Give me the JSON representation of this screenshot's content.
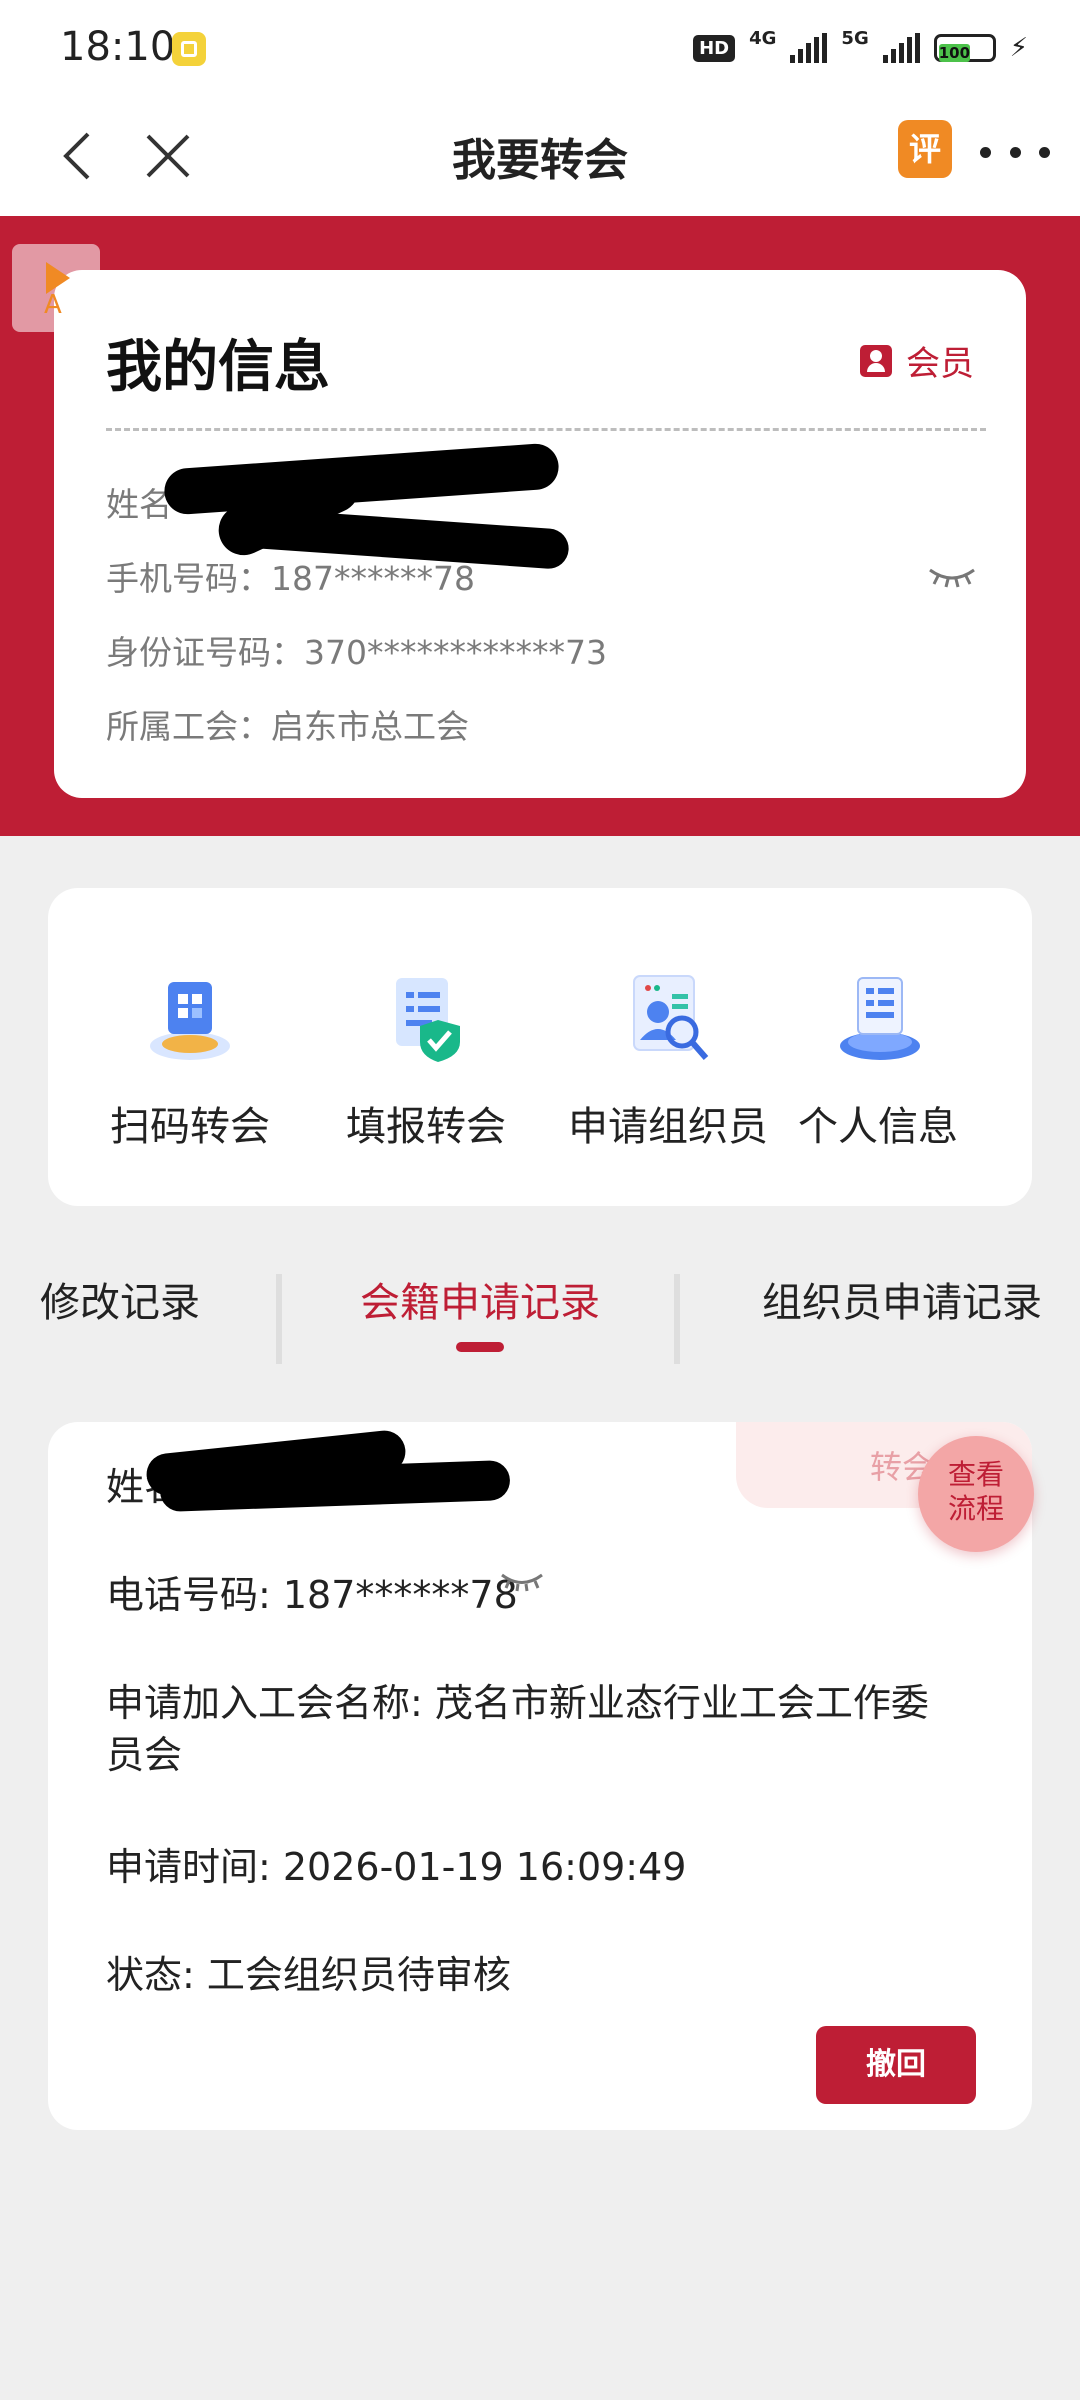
{
  "status_bar": {
    "time": "18:10",
    "hd": "HD",
    "net1": "4G",
    "net2": "5G",
    "battery": "100"
  },
  "navbar": {
    "title": "我要转会",
    "review_label": "评"
  },
  "info": {
    "title": "我的信息",
    "member_label": "会员",
    "name": "姓名",
    "phone": "手机号码：187******78",
    "id_number": "身份证号码：370************73",
    "union": "所属工会：启东市总工会"
  },
  "actions": [
    {
      "label": "扫码转会",
      "icon": "qr-transfer-icon"
    },
    {
      "label": "填报转会",
      "icon": "form-transfer-icon"
    },
    {
      "label": "申请组织员",
      "icon": "apply-organizer-icon"
    },
    {
      "label": "个人信息",
      "icon": "personal-info-icon"
    }
  ],
  "tabs": {
    "items": [
      "修改记录",
      "会籍申请记录",
      "组织员申请记录"
    ],
    "active_index": 1
  },
  "record": {
    "corner_label": "转会记",
    "name": "姓名:",
    "phone": "电话号码: 187******78",
    "union_line1": "申请加入工会名称: 茂名市新业态行业工会工作委",
    "union_line2": "员会",
    "time": "申请时间: 2026-01-19 16:09:49",
    "status": "状态: 工会组织员待审核",
    "revoke_label": "撤回"
  },
  "flow_button": {
    "line1": "查看",
    "line2": "流程"
  },
  "colors": {
    "accent": "#be1e35",
    "page_bg": "#efefef",
    "review_icon": "#f08a24"
  }
}
